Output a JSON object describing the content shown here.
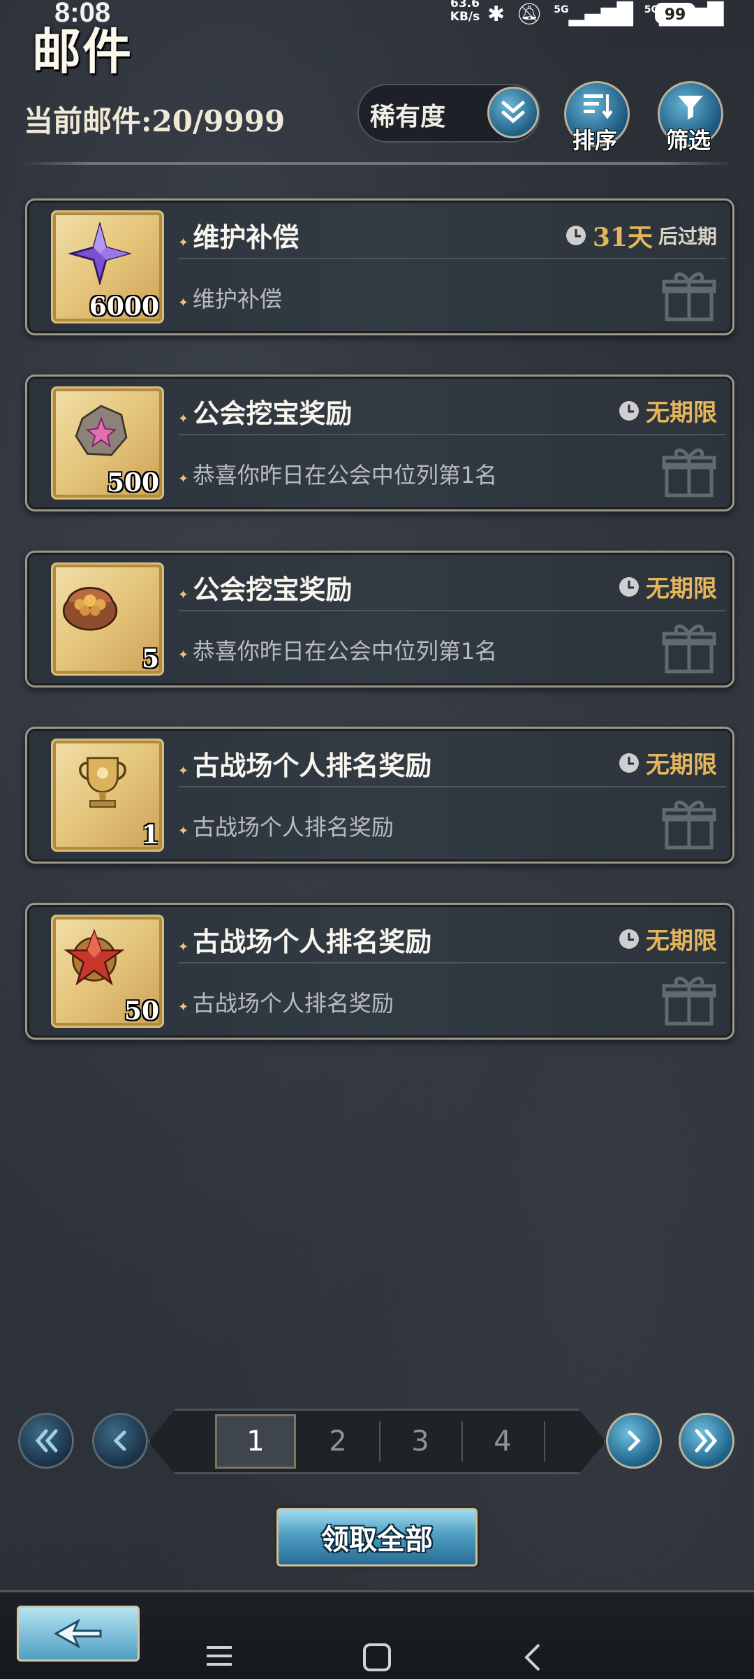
{
  "status_bar": {
    "time": "8:08",
    "net_speed_value": "63.6",
    "net_speed_unit": "KB/s",
    "signal_labels": [
      "5G",
      "5G"
    ],
    "battery": "99"
  },
  "header": {
    "title": "邮件",
    "mail_count_label": "当前邮件:",
    "mail_count_value": "20/9999",
    "rarity_select": "稀有度",
    "sort_label": "排序",
    "filter_label": "筛选"
  },
  "mails": [
    {
      "title": "维护补偿",
      "subtitle": "维护补偿",
      "qty": "6000",
      "expiry_num": "31天",
      "expiry_text": "后过期",
      "icon": "purple-star-crystal-icon"
    },
    {
      "title": "公会挖宝奖励",
      "subtitle": "恭喜你昨日在公会中位列第1名",
      "qty": "500",
      "expiry": "无期限",
      "icon": "star-stone-icon"
    },
    {
      "title": "公会挖宝奖励",
      "subtitle": "恭喜你昨日在公会中位列第1名",
      "qty": "5",
      "expiry": "无期限",
      "icon": "treasure-pouch-icon"
    },
    {
      "title": "古战场个人排名奖励",
      "subtitle": "古战场个人排名奖励",
      "qty": "1",
      "expiry": "无期限",
      "icon": "trophy-icon"
    },
    {
      "title": "古战场个人排名奖励",
      "subtitle": "古战场个人排名奖励",
      "qty": "50",
      "expiry": "无期限",
      "icon": "red-star-medal-icon"
    }
  ],
  "pagination": {
    "pages": [
      "1",
      "2",
      "3",
      "4"
    ],
    "current": "1"
  },
  "claim_all_label": "领取全部",
  "colors": {
    "gold": "#e4b65c",
    "accent_blue": "#4f9ec4",
    "card_bg": "#2f363e"
  }
}
